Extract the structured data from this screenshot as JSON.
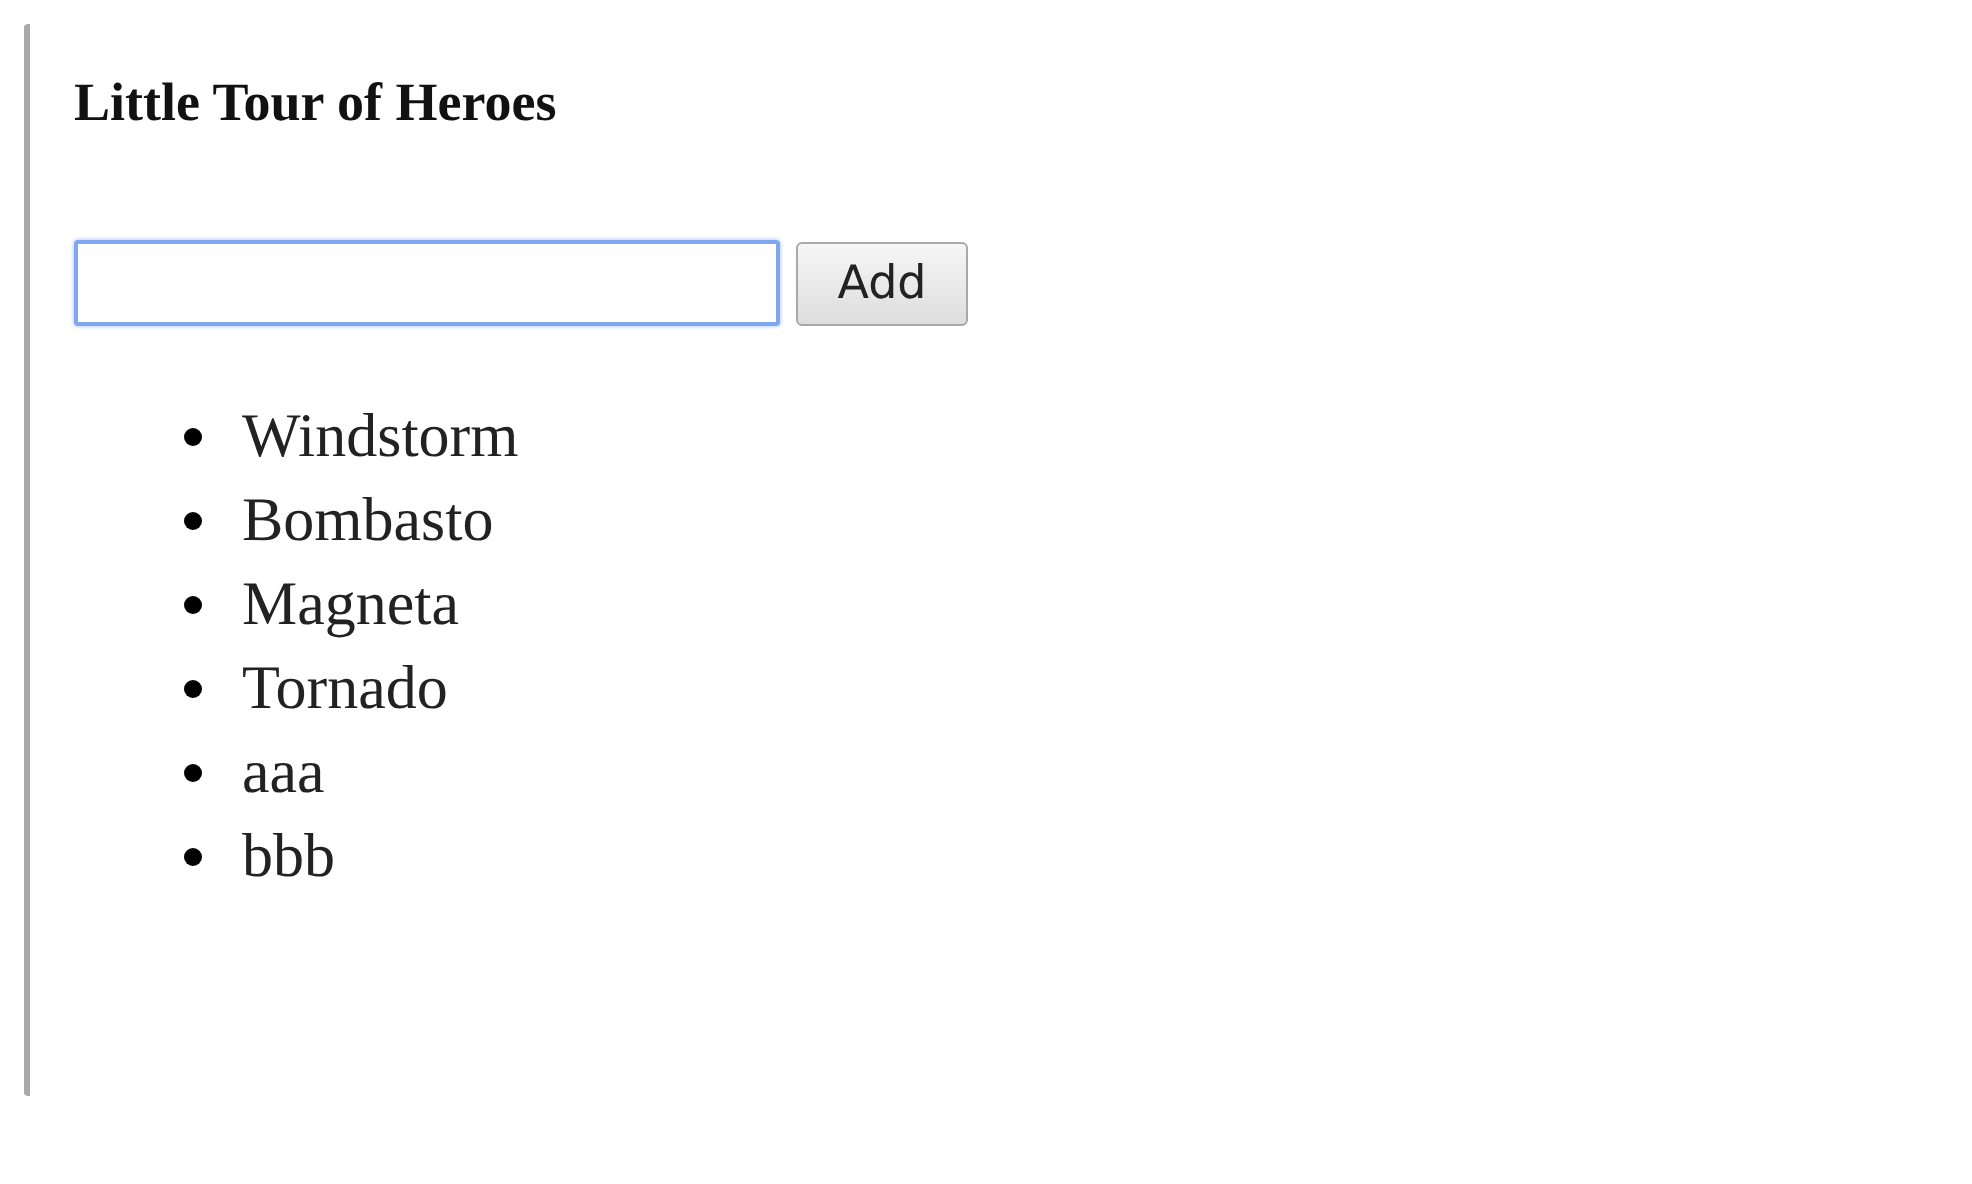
{
  "title": "Little Tour of Heroes",
  "hero_input": {
    "focused": true
  },
  "add_button": "Add",
  "heroes": [
    "Windstorm",
    "Bombasto",
    "Magneta",
    "Tornado",
    "aaa",
    "bbb"
  ]
}
